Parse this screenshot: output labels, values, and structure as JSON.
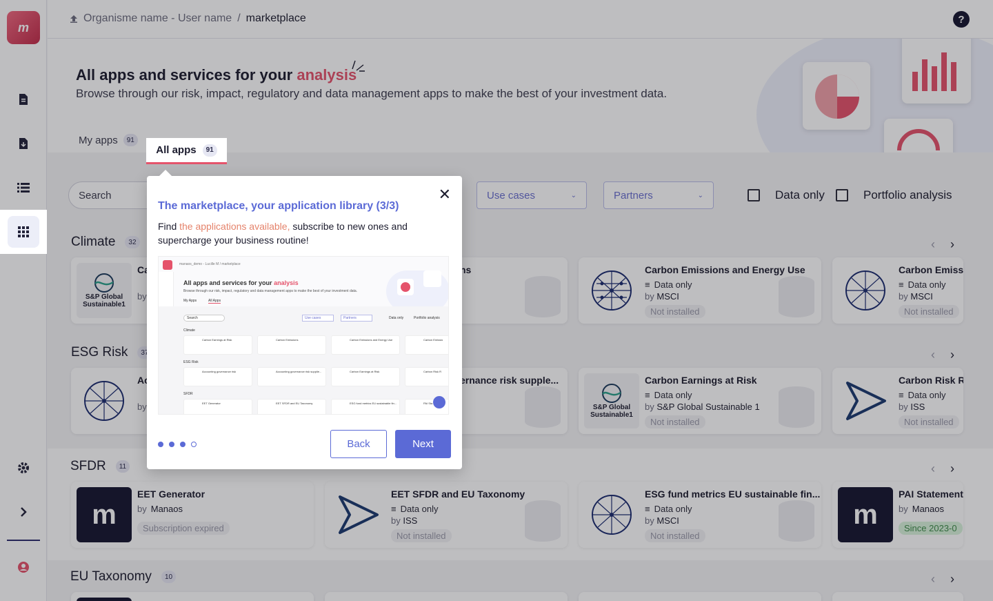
{
  "topbar": {
    "breadcrumb_parent": "Organisme name - User name",
    "separator": "/",
    "breadcrumb_current": "marketplace",
    "help": "?"
  },
  "sidebar": {
    "logo": "m",
    "items": [
      "document-icon",
      "download-icon",
      "list-icon",
      "grid-icon",
      "gear-icon",
      "chevron-right-icon",
      "user-icon"
    ]
  },
  "hero": {
    "title": "All apps and services for your",
    "title_accent": "analysis",
    "subtitle": "Browse through our risk, impact, regulatory and data management apps to make the best of your investment data."
  },
  "tabs": {
    "my_apps": {
      "label": "My apps",
      "count": "91"
    },
    "all_apps": {
      "label": "All apps",
      "count": "91"
    }
  },
  "filters": {
    "search_placeholder": "Search",
    "use_cases": "Use cases",
    "partners": "Partners",
    "data_only": "Data only",
    "portfolio_analysis": "Portfolio analysis"
  },
  "sections": {
    "climate": {
      "name": "Climate",
      "count": "32"
    },
    "esg": {
      "name": "ESG Risk",
      "count": "37"
    },
    "sfdr": {
      "name": "SFDR",
      "count": "11"
    },
    "eu": {
      "name": "EU Taxonomy",
      "count": "10"
    }
  },
  "cards": {
    "c1": {
      "title": "Ca",
      "by": "by",
      "logo": "S&P Global Sustainable1"
    },
    "c2": {
      "title": "ns"
    },
    "c3": {
      "title": "Carbon Emissions and Energy Use",
      "type": "Data only",
      "by_prefix": "by",
      "by": "MSCI",
      "status": "Not installed"
    },
    "c4": {
      "title": "Carbon Emissi",
      "type": "Data only",
      "by_prefix": "by",
      "by": "MSCI",
      "status": "Not installed"
    },
    "e1": {
      "title": "Ac",
      "by": "by"
    },
    "e2": {
      "title": "ernance risk supple..."
    },
    "e3": {
      "title": "Carbon Earnings at Risk",
      "type": "Data only",
      "by_prefix": "by",
      "by": "S&P Global Sustainable 1",
      "status": "Not installed",
      "logo": "S&P Global Sustainable1"
    },
    "e4": {
      "title": "Carbon Risk R",
      "type": "Data only",
      "by_prefix": "by",
      "by": "ISS",
      "status": "Not installed"
    },
    "s1": {
      "title": "EET Generator",
      "by_prefix": "by",
      "by": "Manaos",
      "status": "Subscription expired",
      "logo": "m"
    },
    "s2": {
      "title": "EET SFDR and EU Taxonomy",
      "type": "Data only",
      "by_prefix": "by",
      "by": "ISS",
      "status": "Not installed"
    },
    "s3": {
      "title": "ESG fund metrics EU sustainable fin...",
      "type": "Data only",
      "by_prefix": "by",
      "by": "MSCI",
      "status": "Not installed"
    },
    "s4": {
      "title": "PAI Statement",
      "by_prefix": "by",
      "by": "Manaos",
      "status": "Since 2023-0",
      "logo": "m"
    }
  },
  "modal": {
    "title": "The marketplace, your application library (3/3)",
    "body_pre": "Find ",
    "body_highlight": "the applications available,",
    "body_post": " subscribe to new ones and supercharge your business routine!",
    "back": "Back",
    "next": "Next",
    "close": "✕"
  },
  "preview": {
    "crumb": "manaos_demo - Lucille M / marketplace",
    "title": "All apps and services for your",
    "title_accent": "analysis",
    "subtitle": "Browse through our risk, impact, regulatory and data management apps to make the best of your investment data.",
    "tab1": "My Apps",
    "tab2": "All Apps",
    "search": "Search",
    "use_cases": "Use cases",
    "partners": "Partners",
    "data_only": "Data only",
    "portfolio": "Portfolio analysis",
    "sec1": "Climate",
    "sec2": "ESG Risk",
    "sec3": "SFDR",
    "c1": "Carbon Earnings at Risk",
    "c2": "Carbon Emissions",
    "c3": "Carbon Emissions and Energy Use",
    "c4": "Carbon Emissio",
    "e1": "Accounting governance risk",
    "e2": "Accounting governance risk supplie...",
    "e3": "Carbon Earnings at Risk",
    "e4": "Carbon Risk R",
    "s1": "EET Generator",
    "s2": "EET SFDR and EU Taxonomy",
    "s3": "ESG fund metrics EU sustainable fin...",
    "s4": "PAI Sta"
  },
  "colors": {
    "accent": "#e5536b",
    "primary": "#5b6ad6",
    "dark": "#151530"
  }
}
